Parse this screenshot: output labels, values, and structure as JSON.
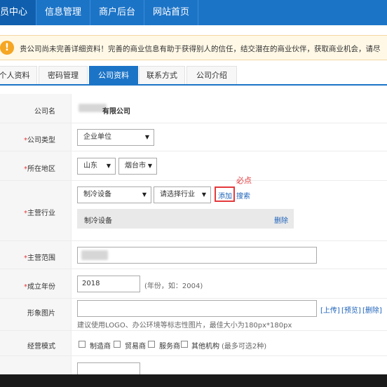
{
  "topnav": {
    "items": [
      "员中心",
      "信息管理",
      "商户后台",
      "网站首页"
    ]
  },
  "notice": {
    "text": "贵公司尚未完善详细资料！完善的商业信息有助于获得别人的信任，结交潜在的商业伙伴，获取商业机会，请尽"
  },
  "tabs": [
    "个人资料",
    "密码管理",
    "公司资料",
    "联系方式",
    "公司介绍"
  ],
  "form": {
    "company_name": {
      "label": "公司名",
      "value": "有限公司"
    },
    "company_type": {
      "label": "公司类型",
      "value": "企业单位"
    },
    "region": {
      "label": "所在地区",
      "province": "山东",
      "city": "烟台市"
    },
    "industry": {
      "label": "主营行业",
      "select1": "制冷设备",
      "select2": "请选择行业",
      "add_label": "添加",
      "search_label": "搜索",
      "annotation": "必点",
      "selected_item": "制冷设备",
      "delete_label": "删除"
    },
    "scope": {
      "label": "主营范围"
    },
    "founded": {
      "label": "成立年份",
      "value": "2018",
      "hint": "(年份，如：2004)"
    },
    "image": {
      "label": "形象图片",
      "upload": "[上传]",
      "preview": "[预览]",
      "delete": "[删除]",
      "hint": "建议使用LOGO、办公环境等标志性图片，最佳大小为180px*180px"
    },
    "mode": {
      "label": "经营模式",
      "options": [
        "制造商",
        "贸易商",
        "服务商",
        "其他机构"
      ],
      "hint": "(最多可选2种)"
    }
  },
  "required_mark": "*",
  "colors": {
    "nav": "#1c74c7",
    "required": "#e4393c",
    "link": "#1c62b9",
    "annotation": "#e4393c"
  }
}
